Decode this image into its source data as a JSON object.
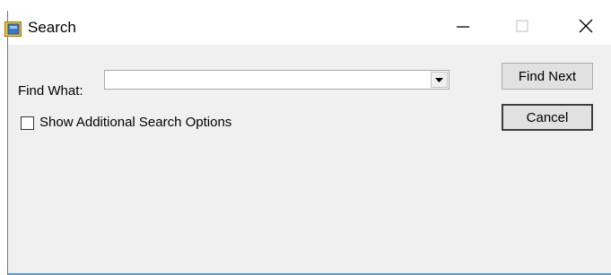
{
  "window": {
    "title": "Search",
    "icon": "app-form-icon",
    "controls": {
      "minimize_icon": "minimize-icon",
      "maximize_icon": "maximize-icon",
      "close_icon": "close-icon"
    }
  },
  "form": {
    "find_label": "Find What:",
    "find_value": "",
    "dropdown_icon": "chevron-down-icon",
    "show_options_label": "Show Additional Search Options",
    "show_options_checked": false
  },
  "buttons": {
    "find_next": "Find Next",
    "cancel": "Cancel"
  },
  "colors": {
    "window_bg": "#f0f0f0",
    "titlebar_bg": "#ffffff",
    "accent_edge": "#5b9bd5"
  }
}
